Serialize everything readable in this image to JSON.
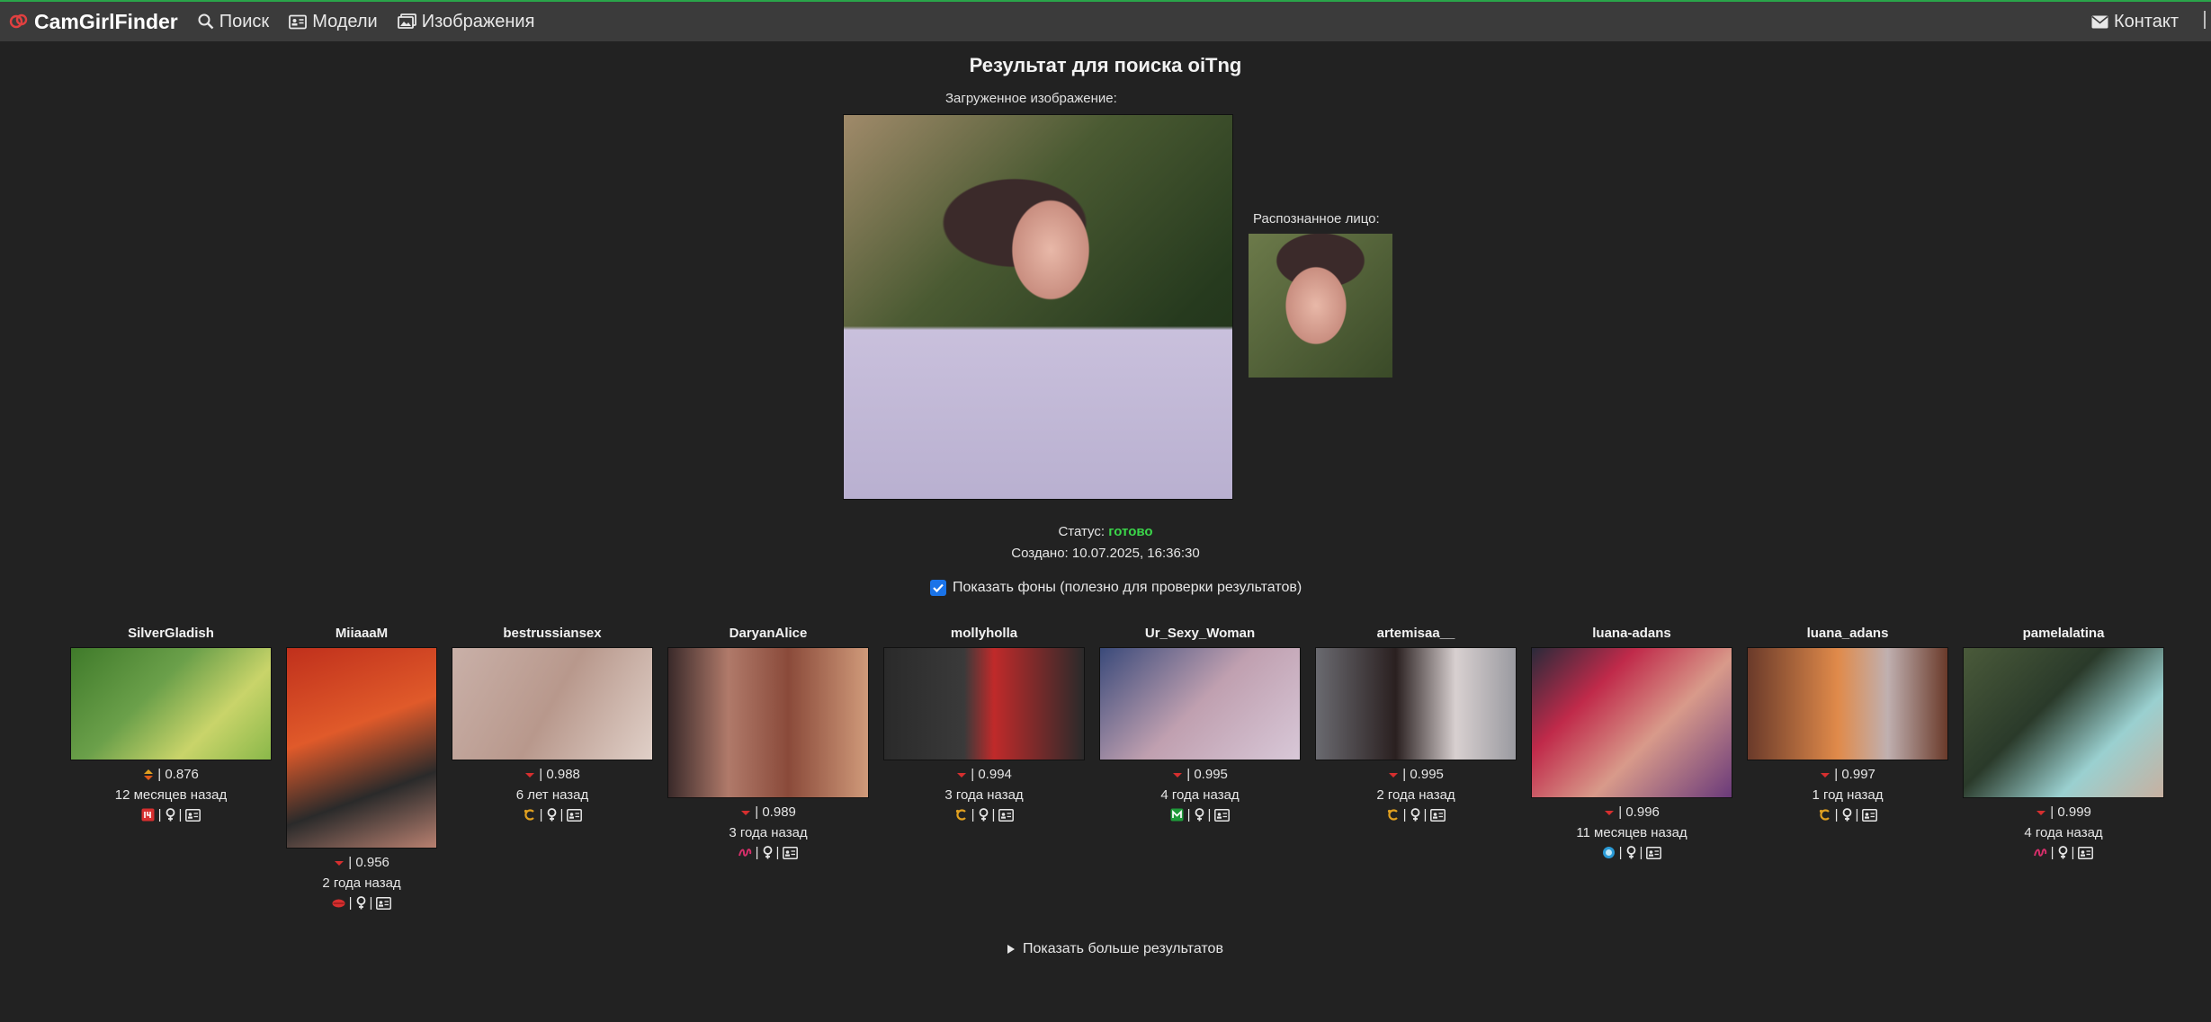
{
  "nav": {
    "brand": "CamGirlFinder",
    "search": "Поиск",
    "models": "Модели",
    "images": "Изображения",
    "contact": "Контакт"
  },
  "page": {
    "title": "Результат для поиска oiTng",
    "uploaded_label": "Загруженное изображение:",
    "face_label": "Распознанное лицо:",
    "status_label": "Статус:",
    "status_value": "готово",
    "created": "Создано: 10.07.2025, 16:36:30",
    "show_backgrounds": "Показать фоны (полезно для проверки результатов)",
    "show_more": "Показать больше результатов"
  },
  "colors": {
    "navbar": "#3b3b3b",
    "background": "#222222",
    "status_ok": "#3bd64a",
    "accent": "#d62f2f"
  },
  "results": [
    {
      "name": "SilverGladish",
      "score": "0.876",
      "time": "12 месяцев назад",
      "trend": "updown",
      "site_icon": "red-square-logo-icon"
    },
    {
      "name": "MiiaaaM",
      "score": "0.956",
      "time": "2 года назад",
      "trend": "down",
      "site_icon": "red-lips-logo-icon"
    },
    {
      "name": "bestrussiansex",
      "score": "0.988",
      "time": "6 лет назад",
      "trend": "down",
      "site_icon": "gold-c-logo-icon"
    },
    {
      "name": "DaryanAlice",
      "score": "0.989",
      "time": "3 года назад",
      "trend": "down",
      "site_icon": "pink-script-logo-icon"
    },
    {
      "name": "mollyholla",
      "score": "0.994",
      "time": "3 года назад",
      "trend": "down",
      "site_icon": "gold-c-logo-icon"
    },
    {
      "name": "Ur_Sexy_Woman",
      "score": "0.995",
      "time": "4 года назад",
      "trend": "down",
      "site_icon": "green-m-logo-icon"
    },
    {
      "name": "artemisaa__",
      "score": "0.995",
      "time": "2 года назад",
      "trend": "down",
      "site_icon": "gold-c-logo-icon"
    },
    {
      "name": "luana-adans",
      "score": "0.996",
      "time": "11 месяцев назад",
      "trend": "down",
      "site_icon": "blue-circle-logo-icon"
    },
    {
      "name": "luana_adans",
      "score": "0.997",
      "time": "1 год назад",
      "trend": "down",
      "site_icon": "gold-c-logo-icon"
    },
    {
      "name": "pamelalatina",
      "score": "0.999",
      "time": "4 года назад",
      "trend": "down",
      "site_icon": "pink-script-logo-icon"
    }
  ]
}
